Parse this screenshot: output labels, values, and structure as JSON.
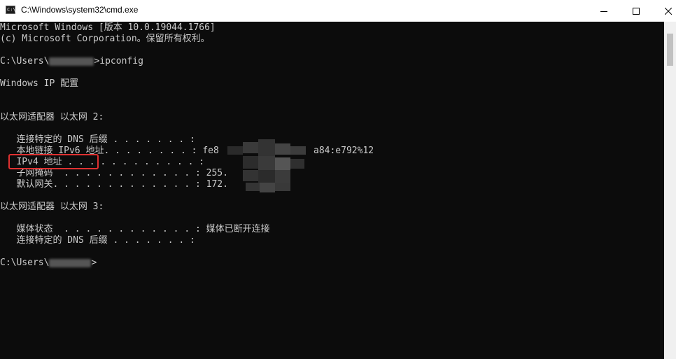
{
  "window": {
    "title": "C:\\Windows\\system32\\cmd.exe",
    "icon": "cmd-icon",
    "buttons": {
      "minimize": "minimize-icon",
      "maximize": "maximize-icon",
      "close": "close-icon"
    }
  },
  "console": {
    "banner_1": "Microsoft Windows [版本 10.0.19044.1766]",
    "banner_2": "(c) Microsoft Corporation。保留所有权利。",
    "prompt_1_prefix": "C:\\Users\\",
    "prompt_1_command": ">ipconfig",
    "ip_config_title": "Windows IP 配置",
    "adapter_2_header": "以太网适配器 以太网 2:",
    "adapter_2": {
      "dns_suffix": "   连接特定的 DNS 后缀 . . . . . . . :",
      "ipv6": "   本地链接 IPv6 地址. . . . . . . . : fe8",
      "ipv6_tail": "a84:e792%12",
      "ipv4": "   IPv4 地址 . . . . . . . . . . . . :",
      "subnet": "   子网掩码  . . . . . . . . . . . . : 255.",
      "gateway": "   默认网关. . . . . . . . . . . . . : 172."
    },
    "adapter_3_header": "以太网适配器 以太网 3:",
    "adapter_3": {
      "media_state": "   媒体状态  . . . . . . . . . . . . : 媒体已断开连接",
      "dns_suffix": "   连接特定的 DNS 后缀 . . . . . . . :"
    },
    "prompt_2_prefix": "C:\\Users\\",
    "prompt_2_suffix": ">"
  },
  "colors": {
    "console_bg": "#0c0c0c",
    "console_text": "#cccccc",
    "highlight": "#e03131"
  }
}
